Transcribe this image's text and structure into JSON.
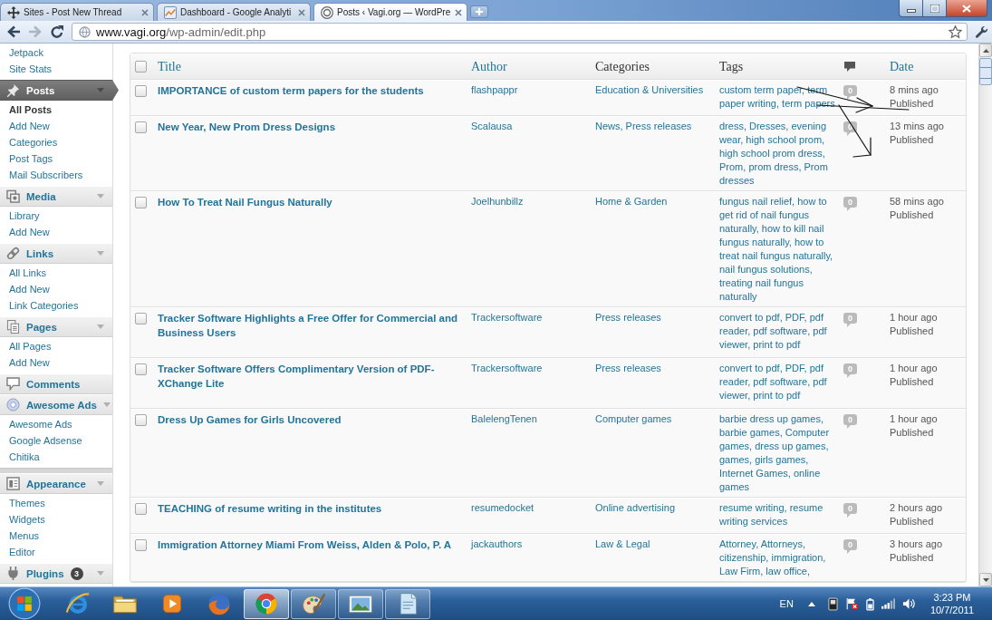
{
  "browser": {
    "tabs": [
      {
        "title": "Sites - Post New Thread",
        "selected": false
      },
      {
        "title": "Dashboard - Google Analyti",
        "selected": false
      },
      {
        "title": "Posts ‹ Vagi.org — WordPre",
        "selected": true
      }
    ],
    "nav_buttons": [
      {
        "disabled": false
      },
      {
        "disabled": true
      },
      {
        "disabled": false
      }
    ],
    "address": {
      "host": "www.vagi.org",
      "path": "/wp-admin/edit.php"
    },
    "bookmarked": false
  },
  "sidebar": {
    "sections": [
      {
        "kind": "list",
        "items": [
          {
            "label": "Jetpack",
            "selected": false
          },
          {
            "label": "Site Stats",
            "selected": false
          }
        ]
      },
      {
        "kind": "menu",
        "label": "Posts",
        "current": true,
        "collapsible": true,
        "items": [
          {
            "label": "All Posts",
            "selected": true
          },
          {
            "label": "Add New",
            "selected": false
          },
          {
            "label": "Categories",
            "selected": false
          },
          {
            "label": "Post Tags",
            "selected": false
          },
          {
            "label": "Mail Subscribers",
            "selected": false
          }
        ]
      },
      {
        "kind": "menu",
        "label": "Media",
        "current": false,
        "collapsible": true,
        "items": [
          {
            "label": "Library",
            "selected": false
          },
          {
            "label": "Add New",
            "selected": false
          }
        ]
      },
      {
        "kind": "menu",
        "label": "Links",
        "current": false,
        "collapsible": true,
        "items": [
          {
            "label": "All Links",
            "selected": false
          },
          {
            "label": "Add New",
            "selected": false
          },
          {
            "label": "Link Categories",
            "selected": false
          }
        ]
      },
      {
        "kind": "menu",
        "label": "Pages",
        "current": false,
        "collapsible": true,
        "items": [
          {
            "label": "All Pages",
            "selected": false
          },
          {
            "label": "Add New",
            "selected": false
          }
        ]
      },
      {
        "kind": "menu",
        "label": "Comments",
        "current": false,
        "collapsible": false
      },
      {
        "kind": "menu",
        "label": "Awesome Ads",
        "current": false,
        "collapsible": true,
        "items": [
          {
            "label": "Awesome Ads",
            "selected": false
          },
          {
            "label": "Google Adsense",
            "selected": false
          },
          {
            "label": "Chitika",
            "selected": false
          }
        ]
      },
      {
        "kind": "separator"
      },
      {
        "kind": "menu",
        "label": "Appearance",
        "current": false,
        "collapsible": true,
        "items": [
          {
            "label": "Themes",
            "selected": false
          },
          {
            "label": "Widgets",
            "selected": false
          },
          {
            "label": "Menus",
            "selected": false
          },
          {
            "label": "Editor",
            "selected": false
          }
        ]
      },
      {
        "kind": "menu",
        "label": "Plugins",
        "current": false,
        "collapsible": true,
        "badge": "3"
      }
    ]
  },
  "posts_table": {
    "select_all": {
      "checked": false
    },
    "columns": [
      {
        "kind": "text",
        "label": "Title",
        "sortable": true
      },
      {
        "kind": "text",
        "label": "Author",
        "sortable": true
      },
      {
        "kind": "text",
        "label": "Categories",
        "sortable": false
      },
      {
        "kind": "text",
        "label": "Tags",
        "sortable": false
      },
      {
        "kind": "icon"
      },
      {
        "kind": "text",
        "label": "Date",
        "sortable": true
      }
    ],
    "rows": [
      {
        "checked": false,
        "title": "IMPORTANCE of custom term papers for the students",
        "author": "flashpappr",
        "categories": "Education & Universities",
        "tags": "custom term paper, term paper writing, term papers",
        "comments": "0",
        "date": "8 mins ago",
        "status": "Published"
      },
      {
        "checked": false,
        "title": "New Year, New Prom Dress Designs",
        "author": "Scalausa",
        "categories": "News, Press releases",
        "tags": "dress, Dresses, evening wear, high school prom, high school prom dress, Prom, prom dress, Prom dresses",
        "comments": "0",
        "date": "13 mins ago",
        "status": "Published"
      },
      {
        "checked": false,
        "title": "How To Treat Nail Fungus Naturally",
        "author": "Joelhunbillz",
        "categories": "Home & Garden",
        "tags": "fungus nail relief, how to get rid of nail fungus naturally, how to kill nail fungus naturally, how to treat nail fungus naturally, nail fungus solutions, treating nail fungus naturally",
        "comments": "0",
        "date": "58 mins ago",
        "status": "Published"
      },
      {
        "checked": false,
        "title": "Tracker Software Highlights a Free Offer for Commercial and Business Users",
        "author": "Trackersoftware",
        "categories": "Press releases",
        "tags": "convert to pdf, PDF, pdf reader, pdf software, pdf viewer, print to pdf",
        "comments": "0",
        "date": "1 hour ago",
        "status": "Published"
      },
      {
        "checked": false,
        "title": "Tracker Software Offers Complimentary Version of PDF-XChange Lite",
        "author": "Trackersoftware",
        "categories": "Press releases",
        "tags": "convert to pdf, PDF, pdf reader, pdf software, pdf viewer, print to pdf",
        "comments": "0",
        "date": "1 hour ago",
        "status": "Published"
      },
      {
        "checked": false,
        "title": "Dress Up Games for Girls Uncovered",
        "author": "BalelengTenen",
        "categories": "Computer games",
        "tags": "barbie dress up games, barbie games, Computer games, dress up games, games, girls games, Internet Games, online games",
        "comments": "0",
        "date": "1 hour ago",
        "status": "Published"
      },
      {
        "checked": false,
        "title": "TEACHING of resume writing in the institutes",
        "author": "resumedocket",
        "categories": "Online advertising",
        "tags": "resume writing, resume writing services",
        "comments": "0",
        "date": "2 hours ago",
        "status": "Published"
      },
      {
        "checked": false,
        "title": "Immigration Attorney Miami From Weiss, Alden & Polo, P. A",
        "author": "jackauthors",
        "categories": "Law & Legal",
        "tags": "Attorney, Attorneys, citizenship, immigration, Law Firm, law office,",
        "comments": "0",
        "date": "3 hours ago",
        "status": "Published"
      }
    ]
  },
  "taskbar": {
    "apps": [
      {
        "running": false,
        "selected": false
      },
      {
        "running": false,
        "selected": false
      },
      {
        "running": false,
        "selected": false
      },
      {
        "running": false,
        "selected": false
      },
      {
        "running": true,
        "selected": true
      },
      {
        "running": true,
        "selected": false
      },
      {
        "running": true,
        "selected": false
      },
      {
        "running": true,
        "selected": false
      }
    ],
    "language": "EN",
    "time": "3:23 PM",
    "date": "10/7/2011"
  }
}
